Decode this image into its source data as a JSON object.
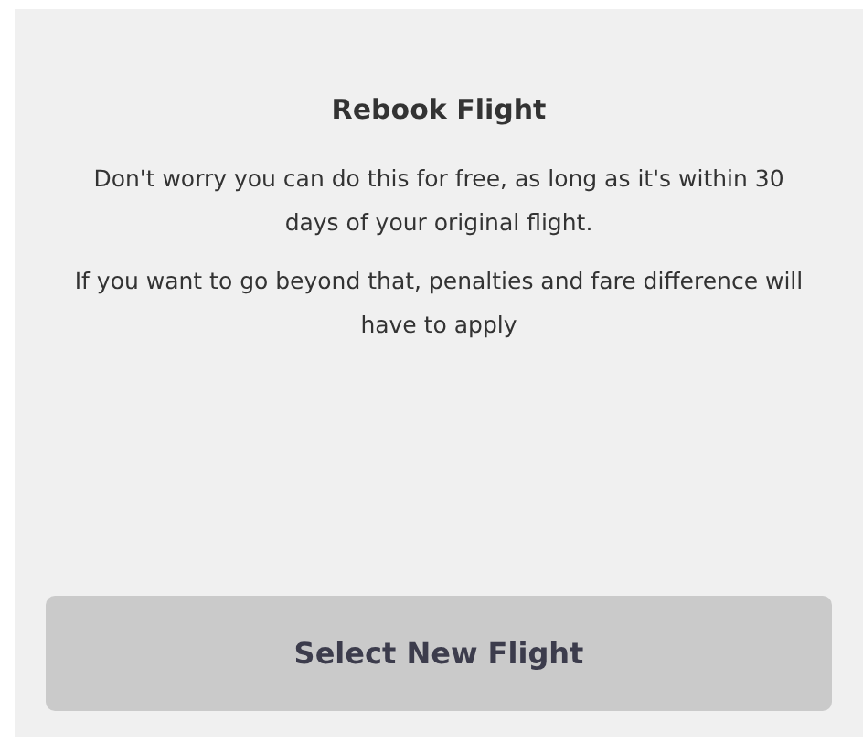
{
  "card": {
    "title": "Rebook Flight",
    "paragraphs": [
      "Don't worry you can do this for free, as long as it's within 30 days of your original flight.",
      "If you want to go beyond that, penalties and fare difference will have to apply"
    ],
    "button": {
      "label": "Select New Flight",
      "disabled": true
    }
  }
}
